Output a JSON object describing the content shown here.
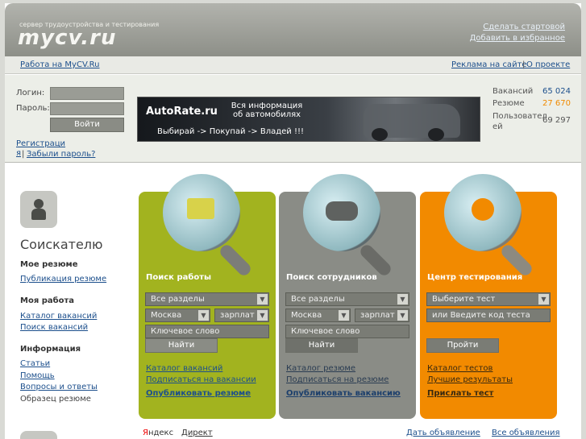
{
  "header": {
    "slogan": "сервер трудоустройства и тестирования",
    "logo": "mycv.ru",
    "links": [
      "Сделать стартовой",
      "Добавить в избранное"
    ]
  },
  "nav": {
    "left": "Работа на MyCV.Ru",
    "right": [
      "Реклама на сайте",
      "О проекте"
    ],
    "separator": "|"
  },
  "login": {
    "login_label": "Логин:",
    "password_label": "Пароль:",
    "submit": "Войти",
    "register": "Регистраци я",
    "separator": "|",
    "forgot": "Забыли пароль?"
  },
  "banner": {
    "brand": "AutoRate.ru",
    "tagline": "Вся информация об автомобилях",
    "slogan": "Выбирай -> Покупай -> Владей !!!"
  },
  "stats": [
    {
      "label": "Вакансий",
      "value": "65 024",
      "color": "#1c4f8c"
    },
    {
      "label": "Резюме",
      "value": "27 670",
      "color": "#f08a00"
    },
    {
      "label": "Пользовател ей",
      "value": "69 297",
      "color": "#555555"
    }
  ],
  "sidebar": {
    "title": "Соискателю",
    "sections": [
      {
        "head": "Мое резюме",
        "links": [
          "Публикация резюме"
        ]
      },
      {
        "head": "Моя работа",
        "links": [
          "Каталог вакансий",
          "Поиск вакансий"
        ]
      },
      {
        "head": "Информация",
        "links": [
          "Статьи",
          "Помощь",
          "Вопросы и ответы"
        ],
        "plain": "Образец резюме"
      }
    ]
  },
  "panels": [
    {
      "title": "Поиск работы",
      "color": "#a2b31f",
      "select_all": "Все разделы",
      "city": "Москва",
      "salary": "зарплат",
      "keyword": "Ключевое слово",
      "button": "Найти",
      "links": [
        "Каталог вакансий",
        "Подписаться на вакансии"
      ],
      "bold_link": "Опубликовать резюме"
    },
    {
      "title": "Поиск сотрудников",
      "color": "#8a8c86",
      "select_all": "Все разделы",
      "city": "Москва",
      "salary": "зарплат",
      "keyword": "Ключевое слово",
      "button": "Найти",
      "links": [
        "Каталог резюме",
        "Подписаться на резюме"
      ],
      "bold_link": "Опубликовать вакансию"
    },
    {
      "title": "Центр тестирования",
      "color": "#f28a00",
      "select_test": "Выберите тест",
      "code": "или Введите код теста",
      "button": "Пройти",
      "links": [
        "Каталог тестов",
        "Лучшие результаты"
      ],
      "bold_link": "Прислать тест"
    }
  ],
  "footer": {
    "yandex_ya": "Я",
    "yandex_rest": "ндекс",
    "direct": "Директ",
    "post_ad": "Дать объявление",
    "all_ads": "Все объявления"
  },
  "colors": {
    "link": "#1c4f8c",
    "green": "#a2b31f",
    "grey": "#8a8c86",
    "orange": "#f28a00"
  }
}
